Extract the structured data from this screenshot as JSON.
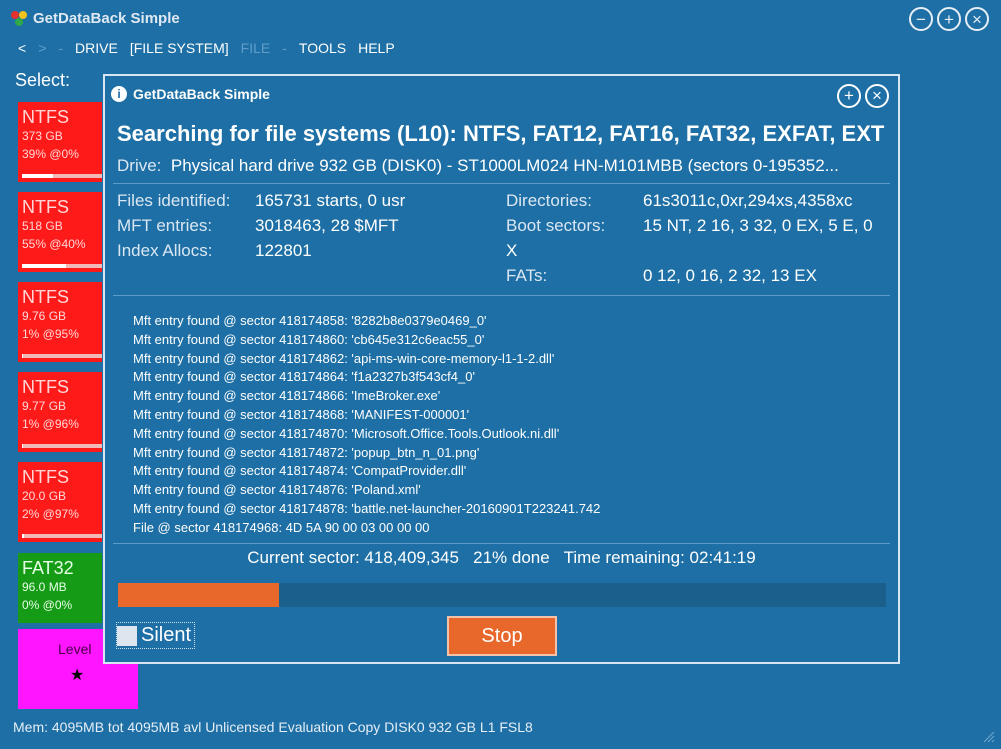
{
  "window": {
    "title": "GetDataBack Simple"
  },
  "menu": {
    "back": "<",
    "forward": ">",
    "sep": "-",
    "drive": "DRIVE",
    "file_system": "[FILE SYSTEM]",
    "file": "FILE",
    "tools": "TOOLS",
    "help": "HELP"
  },
  "select_label": "Select:",
  "tiles": [
    {
      "name": "NTFS",
      "size": "373 GB",
      "pct": "39% @0%",
      "fill": 0.39
    },
    {
      "name": "NTFS",
      "size": "518 GB",
      "pct": "55% @40%",
      "fill": 0.55
    },
    {
      "name": "NTFS",
      "size": "9.76 GB",
      "pct": "1% @95%",
      "fill": 0.01
    },
    {
      "name": "NTFS",
      "size": "9.77 GB",
      "pct": "1% @96%",
      "fill": 0.01
    },
    {
      "name": "NTFS",
      "size": "20.0 GB",
      "pct": "2% @97%",
      "fill": 0.02
    },
    {
      "name": "FAT32",
      "size": "96.0 MB",
      "pct": "0% @0%"
    }
  ],
  "level_tile": {
    "label": "Level",
    "star": "★"
  },
  "dialog": {
    "title": "GetDataBack Simple",
    "heading": "Searching for file systems (L10): NTFS, FAT12, FAT16, FAT32, EXFAT, EXT",
    "drive_label": "Drive:",
    "drive_value": "Physical hard drive 932 GB (DISK0) - ST1000LM024 HN-M101MBB (sectors 0-195352...",
    "stats_left": [
      {
        "k": "Files identified:",
        "v": "165731 starts, 0 usr"
      },
      {
        "k": "MFT entries:",
        "v": "3018463, 28 $MFT"
      },
      {
        "k": "Index Allocs:",
        "v": "122801"
      }
    ],
    "stats_right": [
      {
        "k": "Directories:",
        "v": "61s3011c,0xr,294xs,4358xc"
      },
      {
        "k": "Boot sectors:",
        "v": "15 NT, 2 16, 3 32, 0 EX, 5 E, 0"
      },
      {
        "k": "",
        "v": "X"
      },
      {
        "k": "FATs:",
        "v": "0 12, 0 16, 2 32, 13 EX"
      }
    ],
    "log": [
      "Mft entry found @ sector 418174858: '8282b8e0379e0469_0'",
      "Mft entry found @ sector 418174860: 'cb645e312c6eac55_0'",
      "Mft entry found @ sector 418174862: 'api-ms-win-core-memory-l1-1-2.dll'",
      "Mft entry found @ sector 418174864: 'f1a2327b3f543cf4_0'",
      "Mft entry found @ sector 418174866: 'ImeBroker.exe'",
      "Mft entry found @ sector 418174868: 'MANIFEST-000001'",
      "Mft entry found @ sector 418174870: 'Microsoft.Office.Tools.Outlook.ni.dll'",
      "Mft entry found @ sector 418174872: 'popup_btn_n_01.png'",
      "Mft entry found @ sector 418174874: 'CompatProvider.dll'",
      "Mft entry found @ sector 418174876: 'Poland.xml'",
      "Mft entry found @ sector 418174878: 'battle.net-launcher-20160901T223241.742",
      "File @ sector 418174968:  4D 5A 90 00 03 00 00 00"
    ],
    "status": "Current sector: 418,409,345   21% done   Time remaining: 02:41:19",
    "progress": 0.21,
    "silent_label": "Silent",
    "stop_label": "Stop"
  },
  "statusbar": "Mem: 4095MB tot 4095MB avl  Unlicensed Evaluation Copy   DISK0 932 GB L1 FSL8",
  "colors": {
    "background": "#1d6fa5",
    "accent": "#e8672a",
    "tile_red": "#ff1a1a",
    "tile_green": "#169b16",
    "tile_magenta": "#ff15ff"
  }
}
